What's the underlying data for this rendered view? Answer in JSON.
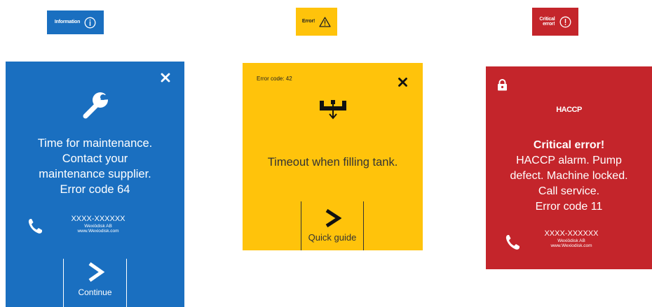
{
  "badges": {
    "info": {
      "label": "Information",
      "color": "#1a6fc0"
    },
    "error": {
      "label": "Error!",
      "color": "#ffc30b"
    },
    "critical": {
      "label_line1": "Critical",
      "label_line2": "error!",
      "color": "#c4252b"
    }
  },
  "info_panel": {
    "message_lines": [
      "Time for maintenance.",
      "Contact your",
      "maintenance supplier.",
      "Error code 64"
    ],
    "phone": "XXXX-XXXXXX",
    "company": "Wexiödisk AB",
    "website": "www.Wexiodisk.com",
    "button_label": "Continue",
    "color": "#1a6fc0"
  },
  "error_panel": {
    "error_code": "Error code: 42",
    "message": "Timeout when filling tank.",
    "button_label": "Quick guide",
    "color": "#ffc30b"
  },
  "critical_panel": {
    "haccp": "HACCP",
    "title": "Critical error!",
    "message_lines": [
      "HACCP alarm. Pump",
      "defect. Machine locked.",
      "Call service.",
      "Error code 11"
    ],
    "phone": "XXXX-XXXXXX",
    "company": "Wexiödisk AB",
    "website": "www.Wexiodisk.com",
    "color": "#c4252b"
  }
}
